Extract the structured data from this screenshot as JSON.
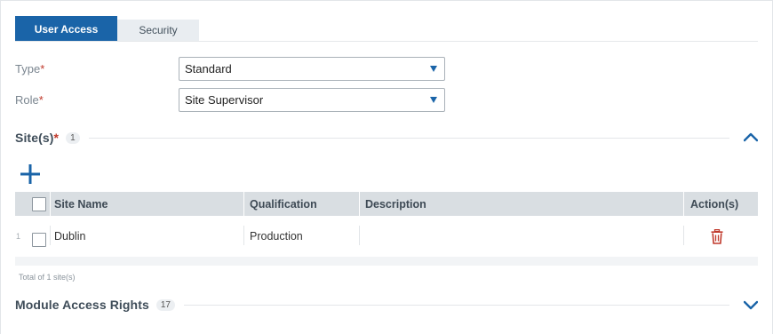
{
  "tabs": [
    {
      "label": "User Access",
      "active": true
    },
    {
      "label": "Security",
      "active": false
    }
  ],
  "form": {
    "type_label": "Type",
    "type_value": "Standard",
    "role_label": "Role",
    "role_value": "Site Supervisor",
    "required_mark": "*"
  },
  "sites_section": {
    "title": "Site(s)",
    "required_mark": "*",
    "count": "1",
    "expanded": true
  },
  "table": {
    "headers": [
      "Site Name",
      "Qualification",
      "Description",
      "Action(s)"
    ],
    "rows": [
      {
        "num": "1",
        "site_name": "Dublin",
        "qualification": "Production",
        "description": ""
      }
    ],
    "total_text": "Total of 1 site(s)"
  },
  "module_section": {
    "title": "Module Access Rights",
    "count": "17",
    "expanded": false
  },
  "colors": {
    "accent": "#1a64a8",
    "delete": "#c0392b"
  },
  "icons": {
    "add": "plus-icon",
    "delete": "trash-icon",
    "collapse": "chevron-up-icon",
    "expand": "chevron-down-icon",
    "dropdown": "caret-down-icon"
  }
}
